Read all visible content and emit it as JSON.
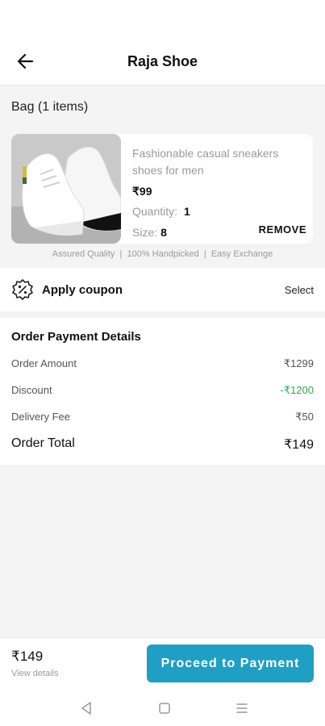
{
  "header": {
    "title": "Raja Shoe"
  },
  "bag": {
    "title": "Bag (1 items)",
    "item": {
      "name": "Fashionable casual sneakers shoes for men",
      "price": "₹99",
      "quantity_label": "Quantity:",
      "quantity": "1",
      "size_label": "Size:",
      "size": "8",
      "remove_label": "REMOVE"
    },
    "assurance": "Assured Quality  |  100% Handpicked  |  Easy Exchange"
  },
  "coupon": {
    "label": "Apply coupon",
    "select_label": "Select"
  },
  "payment": {
    "title": "Order Payment Details",
    "rows": [
      {
        "label": "Order Amount",
        "value": "₹1299"
      },
      {
        "label": "Discount",
        "value": "-₹1200"
      },
      {
        "label": "Delivery Fee",
        "value": "₹50"
      }
    ],
    "total_label": "Order Total",
    "total_value": "₹149"
  },
  "footer": {
    "price": "₹149",
    "view_details": "View details",
    "proceed_label": "Proceed to Payment"
  },
  "colors": {
    "accent": "#1f9fc3",
    "discount": "#2fa84f"
  },
  "icons": {
    "back": "arrow-left-icon",
    "coupon": "percent-badge-icon",
    "nav": [
      "triangle-back-icon",
      "square-home-icon",
      "menu-lines-icon"
    ]
  }
}
